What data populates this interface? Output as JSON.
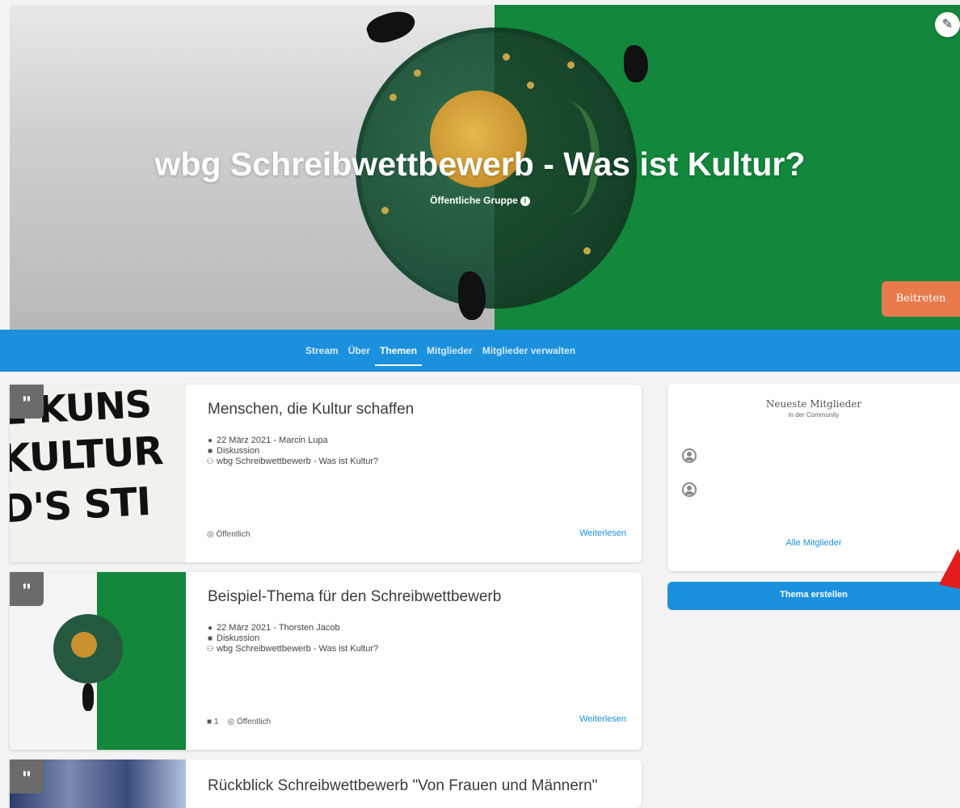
{
  "group": {
    "title": "wbg Schreibwettbewerb - Was ist Kultur?",
    "visibility": "Öffentliche Gruppe",
    "join_label": "Beitreten"
  },
  "nav": {
    "tabs": [
      "Stream",
      "Über",
      "Themen",
      "Mitglieder",
      "Mitglieder verwalten"
    ],
    "active": "Themen"
  },
  "posts": [
    {
      "title": "Menschen, die Kultur schaffen",
      "date_author": "22 März 2021 - Marcin Lupa",
      "type": "Diskussion",
      "group": "wbg Schreibwettbewerb - Was ist Kultur?",
      "comments": "",
      "visibility": "Öffentlich",
      "readmore": "Weiterlesen",
      "thumb_words": [
        "E KUNS",
        "KULTUR",
        "D'S STI"
      ]
    },
    {
      "title": "Beispiel-Thema für den Schreibwettbewerb",
      "date_author": "22 März 2021 - Thorsten Jacob",
      "type": "Diskussion",
      "group": "wbg Schreibwettbewerb - Was ist Kultur?",
      "comments": "1",
      "visibility": "Öffentlich",
      "readmore": "Weiterlesen"
    },
    {
      "title": "Rückblick Schreibwettbewerb \"Von Frauen und Männern\""
    }
  ],
  "sidebar": {
    "title": "Neueste Mitglieder",
    "subtitle": "in der Community",
    "all_members": "Alle Mitglieder",
    "create_topic": "Thema erstellen"
  },
  "colors": {
    "primary": "#1b90dd",
    "join": "#e87a4c",
    "hero_green": "#13873c"
  }
}
